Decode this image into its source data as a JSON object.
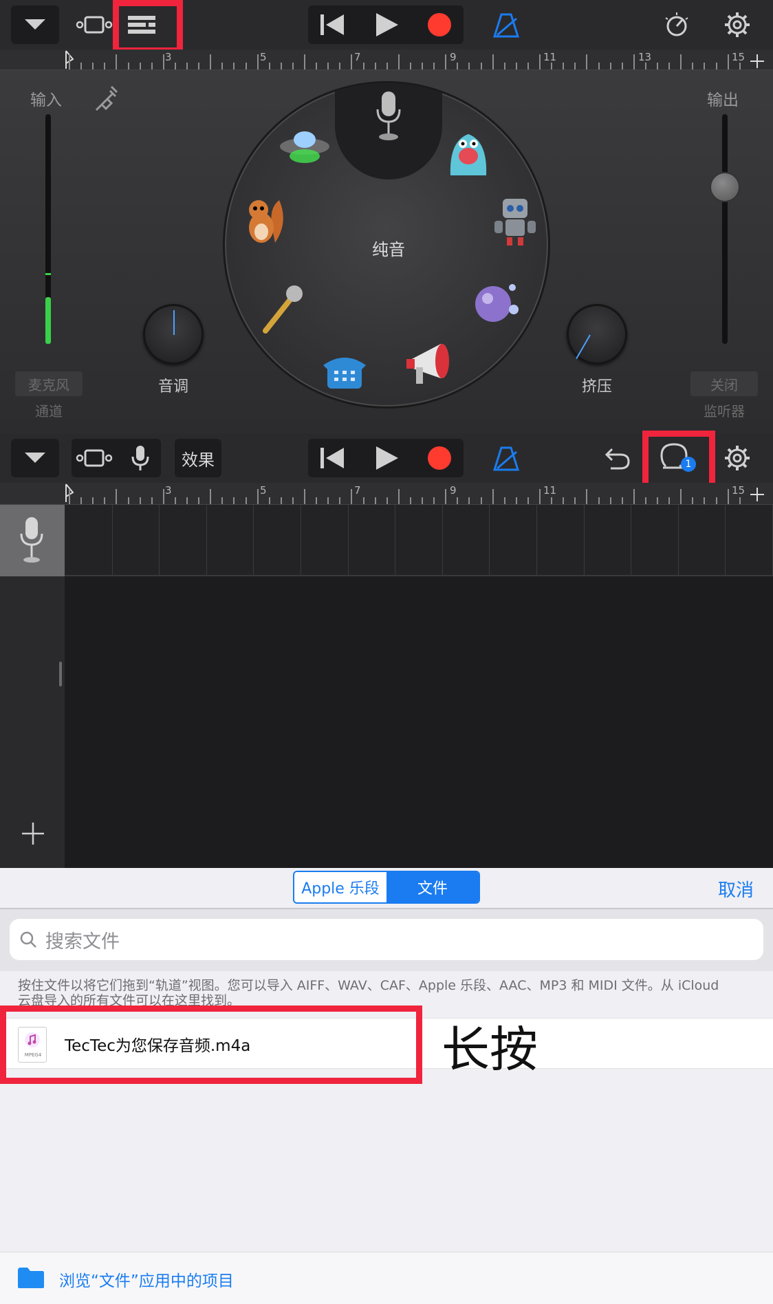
{
  "top_toolbar": {
    "ruler_numbers": [
      "3",
      "5",
      "7",
      "9",
      "11",
      "13",
      "15"
    ]
  },
  "instrument": {
    "input_label": "输入",
    "output_label": "输出",
    "center_label": "纯音",
    "pitch_label": "音调",
    "compress_label": "挤压",
    "mic_button": "麦克风",
    "channel_label": "通道",
    "off_button": "关闭",
    "monitor_label": "监听器"
  },
  "track_toolbar": {
    "effects_label": "效果",
    "loop_badge": "1",
    "ruler_numbers": [
      "3",
      "5",
      "7",
      "9",
      "11",
      "15"
    ]
  },
  "browser": {
    "segments": [
      "Apple 乐段",
      "文件"
    ],
    "selected_segment": "文件",
    "cancel_label": "取消",
    "search_placeholder": "搜索文件",
    "info_text": "按住文件以将它们拖到“轨道”视图。您可以导入 AIFF、WAV、CAF、Apple 乐段、AAC、MP3 和 MIDI 文件。从 iCloud 云盘导入的所有文件可以在这里找到。",
    "file_name": "TecTec为您保存音频.m4a",
    "file_type": "MPEG4",
    "annotation": "长按",
    "browse_label": "浏览“文件”应用中的项目"
  },
  "colors": {
    "highlight": "#f0243c",
    "accent": "#1a7cf0",
    "record": "#ff3b30"
  }
}
